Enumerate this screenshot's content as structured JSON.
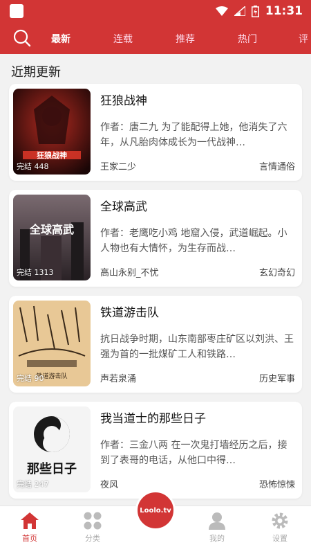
{
  "status_bar": {
    "time": "11:31"
  },
  "top_nav": {
    "tabs": [
      {
        "label": "最新",
        "active": true
      },
      {
        "label": "连载",
        "active": false
      },
      {
        "label": "推荐",
        "active": false
      },
      {
        "label": "热门",
        "active": false
      },
      {
        "label": "评",
        "active": false
      }
    ]
  },
  "section_title": "近期更新",
  "books": [
    {
      "title": "狂狼战神",
      "desc": "作者：唐二九 为了能配得上她，他消失了六年，从凡胎肉体成长为一代战神…",
      "author": "王家二少",
      "genre": "言情通俗",
      "status": "完结 448",
      "cover_text": "狂狼战神",
      "cover_color": "#5a1010"
    },
    {
      "title": "全球高武",
      "desc": "作者：老鹰吃小鸡 地窟入侵，武道崛起。小人物也有大情怀，为生存而战…",
      "author": "高山永别_不忧",
      "genre": "玄幻奇幻",
      "status": "完结 1313",
      "cover_text": "全球高武",
      "cover_color": "#4a3a40"
    },
    {
      "title": "铁道游击队",
      "desc": "抗日战争时期，山东南部枣庄矿区以刘洪、王强为首的一批煤矿工人和铁路…",
      "author": "声若泉涌",
      "genre": "历史军事",
      "status": "完结 90",
      "cover_text": "铁道游击队",
      "cover_color": "#e8c896"
    },
    {
      "title": "我当道士的那些日子",
      "desc": "作者：三金八两 在一次鬼打墙经历之后，接到了表哥的电话，从他口中得…",
      "author": "夜风",
      "genre": "恐怖惊悚",
      "status": "完结 247",
      "cover_text": "那些日子",
      "cover_color": "#f2f2f2"
    }
  ],
  "bottom_nav": {
    "items": [
      {
        "label": "首页",
        "icon": "home-icon",
        "active": true
      },
      {
        "label": "分类",
        "icon": "grid-icon",
        "active": false
      },
      {
        "label": "我的",
        "icon": "user-icon",
        "active": false
      },
      {
        "label": "设置",
        "icon": "gear-icon",
        "active": false
      }
    ],
    "center_label": "Loolo.tv"
  },
  "colors": {
    "accent": "#d23535",
    "background": "#f2f2f2"
  }
}
